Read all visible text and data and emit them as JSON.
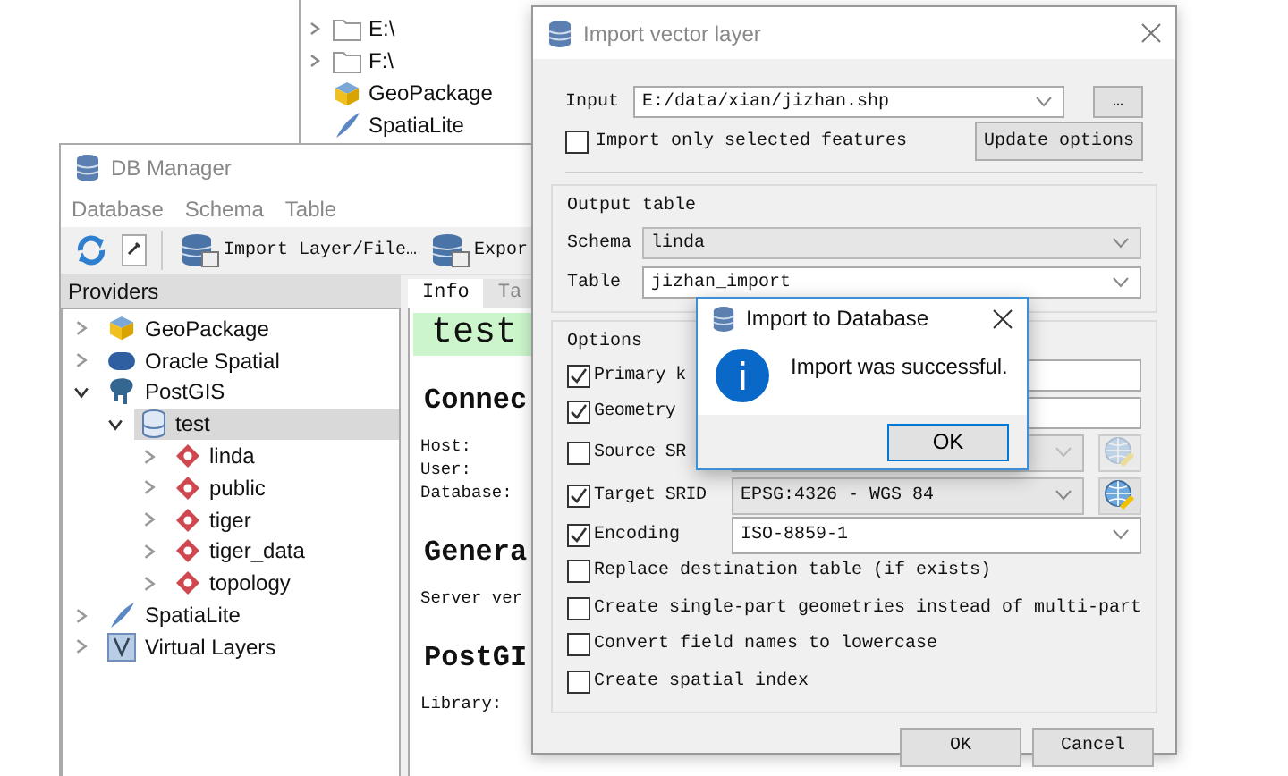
{
  "browser_panel": {
    "items": [
      {
        "label": "E:\\",
        "kind": "folder",
        "expanded": false
      },
      {
        "label": "F:\\",
        "kind": "folder",
        "expanded": false
      },
      {
        "label": "GeoPackage",
        "kind": "geopackage"
      },
      {
        "label": "SpatiaLite",
        "kind": "spatialite"
      }
    ]
  },
  "db_manager": {
    "title": "DB Manager",
    "menu": [
      "Database",
      "Schema",
      "Table"
    ],
    "toolbar": [
      {
        "kind": "refresh"
      },
      {
        "kind": "tool"
      },
      {
        "kind": "import",
        "label": "Import Layer/File…"
      },
      {
        "kind": "export",
        "label": "Expor"
      }
    ],
    "providers_title": "Providers",
    "providers": [
      {
        "label": "GeoPackage",
        "kind": "geopackage",
        "expanded": false,
        "selected": false
      },
      {
        "label": "Oracle Spatial",
        "kind": "oracle",
        "expanded": false,
        "selected": false
      },
      {
        "label": "PostGIS",
        "kind": "postgis",
        "expanded": true,
        "selected": false,
        "children": [
          {
            "label": "test",
            "kind": "database",
            "expanded": true,
            "selected": true,
            "children": [
              {
                "label": "linda",
                "kind": "schema",
                "expanded": false,
                "selected": false
              },
              {
                "label": "public",
                "kind": "schema",
                "expanded": false,
                "selected": false
              },
              {
                "label": "tiger",
                "kind": "schema",
                "expanded": false,
                "selected": false
              },
              {
                "label": "tiger_data",
                "kind": "schema",
                "expanded": false,
                "selected": false
              },
              {
                "label": "topology",
                "kind": "schema",
                "expanded": false,
                "selected": false
              }
            ]
          }
        ]
      },
      {
        "label": "SpatiaLite",
        "kind": "spatialite",
        "expanded": false,
        "selected": false
      },
      {
        "label": "Virtual Layers",
        "kind": "virtual",
        "expanded": false,
        "selected": false
      }
    ],
    "tabs": [
      {
        "label": "Info",
        "selected": true
      },
      {
        "label": "Ta",
        "selected": false
      }
    ],
    "info": {
      "heading": "test",
      "sections": [
        {
          "title": "Connec",
          "lines": [
            "Host:",
            "User:",
            "Database:"
          ]
        },
        {
          "title": "Genera",
          "lines": [
            "Server ver"
          ]
        },
        {
          "title": "PostGI",
          "lines": [
            "Library:"
          ]
        }
      ]
    }
  },
  "import_dialog": {
    "title": "Import vector layer",
    "input": {
      "label": "Input",
      "value": "E:/data/xian/jizhan.shp",
      "browse": "…"
    },
    "selected_only": {
      "label": "Import only selected features",
      "checked": false
    },
    "update_button": "Update options",
    "output_table": {
      "title": "Output table",
      "schema": {
        "label": "Schema",
        "value": "linda",
        "disabled": true
      },
      "table": {
        "label": "Table",
        "value": "jizhan_import",
        "disabled": false
      }
    },
    "options": {
      "title": "Options",
      "rows": [
        {
          "kind": "field",
          "label": "Primary k",
          "checked": true
        },
        {
          "kind": "field",
          "label": "Geometry",
          "checked": true
        },
        {
          "kind": "crs",
          "label": "Source SR",
          "checked": false,
          "disabled": true
        },
        {
          "kind": "crs",
          "label": "Target SRID",
          "checked": true,
          "disabled": false,
          "value": "EPSG:4326 - WGS 84"
        },
        {
          "kind": "select",
          "label": "Encoding",
          "checked": true,
          "value": "ISO-8859-1"
        },
        {
          "kind": "check",
          "label": "Replace destination table (if exists)",
          "checked": false
        },
        {
          "kind": "check",
          "label": "Create single-part geometries instead of multi-part",
          "checked": false
        },
        {
          "kind": "check",
          "label": "Convert field names to lowercase",
          "checked": false
        },
        {
          "kind": "check",
          "label": "Create spatial index",
          "checked": false
        }
      ]
    },
    "buttons": [
      "OK",
      "Cancel"
    ]
  },
  "message_box": {
    "title": "Import to Database",
    "message": "Import was successful.",
    "button": "OK"
  }
}
